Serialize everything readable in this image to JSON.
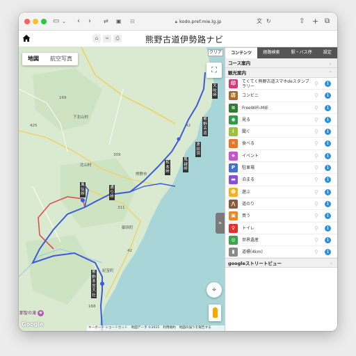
{
  "browser": {
    "url": "kodo.pref.mie.lg.jp"
  },
  "site": {
    "title": "熊野古道伊勢路ナビ"
  },
  "map": {
    "type_tabs": [
      {
        "label": "地図",
        "active": true
      },
      {
        "label": "航空写真",
        "active": false
      }
    ],
    "clear_label": "クリア",
    "collapse_label": "»",
    "google_logo": "Google",
    "attribution": [
      "キーボード ショートカット",
      "地図データ ©2025",
      "利用規約",
      "地図の誤りを報告する"
    ],
    "place_labels": [
      "下北山村",
      "北山村",
      "御浜町",
      "紀宝町",
      "熊野市"
    ],
    "road_numbers": [
      "425",
      "169",
      "311",
      "309",
      "42",
      "168",
      "42"
    ],
    "poi_labels": [
      "大吹峠",
      "熊野古道",
      "波田須",
      "馬越峠",
      "松本峠",
      "通り峠",
      "風伝峠",
      "熊野本宮大社"
    ],
    "nachi_label": "那智の滝",
    "colors": {
      "sea": "#a8d5d7",
      "land": "#d9ead0",
      "route": "#3b5bdb",
      "route_alt": "#e05050"
    }
  },
  "panel": {
    "tabs": [
      {
        "label": "コンテンツ",
        "active": true
      },
      {
        "label": "経路検索",
        "active": false
      },
      {
        "label": "駅・バス停",
        "active": false
      },
      {
        "label": "設定",
        "active": false
      }
    ],
    "course_header": "コース案内",
    "sightseeing_header": "観光案内",
    "items": [
      {
        "label": "てくてく熊野古道スマホdeスタンプラリー",
        "icon": "stamp-icon",
        "color": "#d43a7a",
        "glyph": "印"
      },
      {
        "label": "コンビニ",
        "icon": "store-icon",
        "color": "#a66a2a",
        "glyph": "店"
      },
      {
        "label": "FreeWiFi-MIE",
        "icon": "wifi-icon",
        "color": "#2e7d32",
        "glyph": "≋"
      },
      {
        "label": "見る",
        "icon": "eye-icon",
        "color": "#2e9a4a",
        "glyph": "◉"
      },
      {
        "label": "聞く",
        "icon": "info-i-icon",
        "color": "#9bc23a",
        "glyph": "i"
      },
      {
        "label": "食べる",
        "icon": "cutlery-icon",
        "color": "#e8742a",
        "glyph": "✕"
      },
      {
        "label": "イベント",
        "icon": "event-icon",
        "color": "#c257c9",
        "glyph": "★"
      },
      {
        "label": "駐車場",
        "icon": "parking-icon",
        "color": "#3f6fd8",
        "glyph": "P"
      },
      {
        "label": "泊まる",
        "icon": "bed-icon",
        "color": "#8a4fd8",
        "glyph": "▬"
      },
      {
        "label": "遊ぶ",
        "icon": "play-icon",
        "color": "#f0b020",
        "glyph": "☻"
      },
      {
        "label": "道のり",
        "icon": "path-icon",
        "color": "#8a5a3a",
        "glyph": "⋀"
      },
      {
        "label": "買う",
        "icon": "shopping-bag-icon",
        "color": "#e8862a",
        "glyph": "▣"
      },
      {
        "label": "トイレ",
        "icon": "toilet-icon",
        "color": "#e03030",
        "glyph": "♀"
      },
      {
        "label": "世界遺産",
        "icon": "world-heritage-icon",
        "color": "#3aa54a",
        "glyph": "◎"
      },
      {
        "label": "道標(4km)",
        "icon": "signpost-icon",
        "color": "#8a8a8a",
        "glyph": "▮"
      }
    ],
    "streetview_header": "googleストリートビュー"
  }
}
